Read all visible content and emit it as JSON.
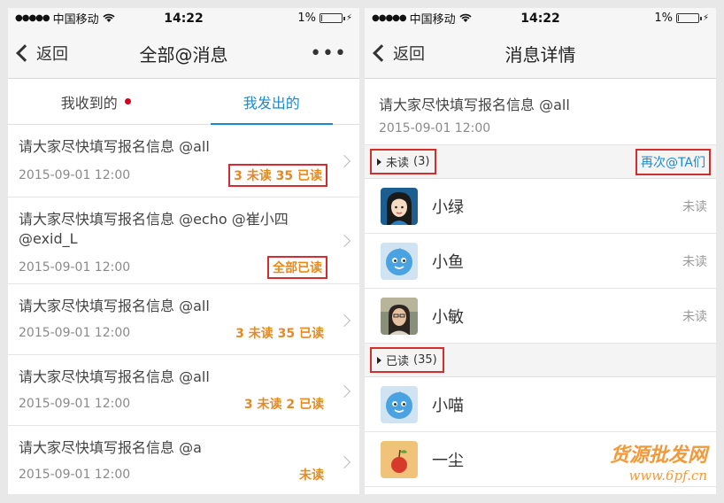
{
  "status_bar": {
    "carrier": "中国移动",
    "time": "14:22",
    "battery": "1%",
    "battery_level": 0.01
  },
  "left": {
    "nav": {
      "back_label": "返回",
      "title": "全部@消息",
      "more_label": "•••"
    },
    "tabs": [
      {
        "label": "我收到的",
        "has_dot": true
      },
      {
        "label": "我发出的",
        "active": true
      }
    ],
    "messages": [
      {
        "text": "请大家尽快填写报名信息  @all",
        "time": "2015-09-01 12:00",
        "status": "3 未读  35 已读",
        "boxed": true
      },
      {
        "text": "请大家尽快填写报名信息  @echo   @崔小四 @exid_L",
        "time": "2015-09-01 12:00",
        "status": "全部已读",
        "boxed": true
      },
      {
        "text": "请大家尽快填写报名信息  @all",
        "time": "2015-09-01 12:00",
        "status": "3 未读  35 已读",
        "boxed": false
      },
      {
        "text": "请大家尽快填写报名信息  @all",
        "time": "2015-09-01 12:00",
        "status": "3 未读  2 已读",
        "boxed": false
      },
      {
        "text": "请大家尽快填写报名信息  @a",
        "time": "2015-09-01 12:00",
        "status": "未读",
        "boxed": false
      }
    ]
  },
  "right": {
    "nav": {
      "back_label": "返回",
      "title": "消息详情"
    },
    "message": {
      "text": "请大家尽快填写报名信息  @all",
      "time": "2015-09-01 12:00"
    },
    "unread_section": {
      "label": "未读",
      "count": "(3)",
      "action_label": "再次@TA们"
    },
    "unread_users": [
      {
        "name": "小绿",
        "state": "未读",
        "avatar": "girl-avatar"
      },
      {
        "name": "小鱼",
        "state": "未读",
        "avatar": "blue-drop-avatar"
      },
      {
        "name": "小敏",
        "state": "未读",
        "avatar": "photo-avatar"
      }
    ],
    "read_section": {
      "label": "已读",
      "count": "(35)"
    },
    "read_users": [
      {
        "name": "小喵",
        "avatar": "blue-drop-avatar"
      },
      {
        "name": "一尘",
        "avatar": "apple-avatar"
      }
    ]
  },
  "watermark": {
    "text": "货源批发网",
    "url": "www.6pf.cn"
  },
  "colors": {
    "accent_blue": "#1a8ad0",
    "status_orange": "#e8891c",
    "highlight_red": "#d32d2d"
  }
}
